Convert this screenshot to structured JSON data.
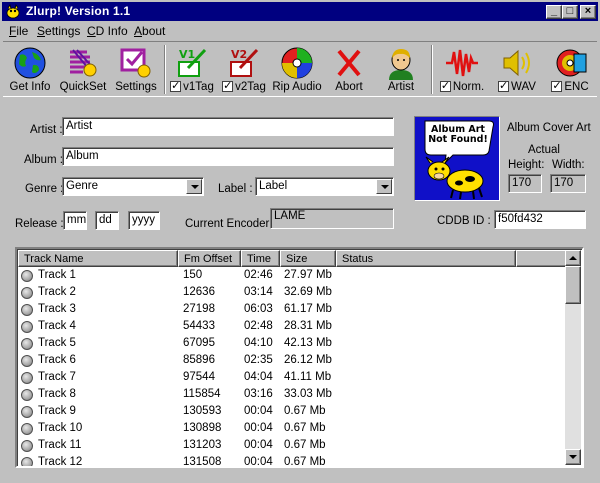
{
  "window": {
    "title": "Zlurp!   Version 1.1"
  },
  "menu": [
    {
      "u": "F",
      "rest": "ile"
    },
    {
      "u": "S",
      "rest": "ettings"
    },
    {
      "u": "C",
      "rest": "D Info"
    },
    {
      "u": "A",
      "rest": "bout"
    }
  ],
  "toolbar": {
    "get_info": "Get Info",
    "quickset": "QuickSet",
    "settings": "Settings",
    "v1tag": "v1Tag",
    "v2tag": "v2Tag",
    "rip_audio": "Rip Audio",
    "abort": "Abort",
    "artist": "Artist",
    "norm": "Norm.",
    "wav": "WAV",
    "enc": "ENC"
  },
  "form": {
    "artist_label": "Artist :",
    "artist_value": "Artist",
    "album_label": "Album :",
    "album_value": "Album",
    "genre_label": "Genre :",
    "genre_value": "Genre",
    "label_label": "Label :",
    "label_value": "Label",
    "release_label": "Release :",
    "release_mm": "mm",
    "release_dd": "dd",
    "release_yyyy": "yyyy",
    "encoder_label": "Current Encoder:",
    "encoder_value": "LAME",
    "cddb_label": "CDDB ID :",
    "cddb_value": "f50fd432"
  },
  "album_art": {
    "placeholder_line1": "Album Art",
    "placeholder_line2": "Not Found!",
    "cover_label": "Album Cover Art",
    "actual_label": "Actual",
    "height_label": "Height:",
    "width_label": "Width:",
    "height_value": "170",
    "width_value": "170"
  },
  "tracklist": {
    "columns": [
      "Track Name",
      "Fm Offset",
      "Time",
      "Size",
      "Status"
    ],
    "rows": [
      [
        "Track 1",
        "150",
        "02:46",
        "27.97 Mb",
        ""
      ],
      [
        "Track 2",
        "12636",
        "03:14",
        "32.69 Mb",
        ""
      ],
      [
        "Track 3",
        "27198",
        "06:03",
        "61.17 Mb",
        ""
      ],
      [
        "Track 4",
        "54433",
        "02:48",
        "28.31 Mb",
        ""
      ],
      [
        "Track 5",
        "67095",
        "04:10",
        "42.13 Mb",
        ""
      ],
      [
        "Track 6",
        "85896",
        "02:35",
        "26.12 Mb",
        ""
      ],
      [
        "Track 7",
        "97544",
        "04:04",
        "41.11 Mb",
        ""
      ],
      [
        "Track 8",
        "115854",
        "03:16",
        "33.03 Mb",
        ""
      ],
      [
        "Track 9",
        "130593",
        "00:04",
        "0.67  Mb",
        ""
      ],
      [
        "Track 10",
        "130898",
        "00:04",
        "0.67  Mb",
        ""
      ],
      [
        "Track 11",
        "131203",
        "00:04",
        "0.67  Mb",
        ""
      ],
      [
        "Track 12",
        "131508",
        "00:04",
        "0.67  Mb",
        ""
      ]
    ]
  },
  "colors": {
    "titlebar": "#000080",
    "window_face": "#c0c0c0",
    "art_bg": "#1010c8"
  }
}
